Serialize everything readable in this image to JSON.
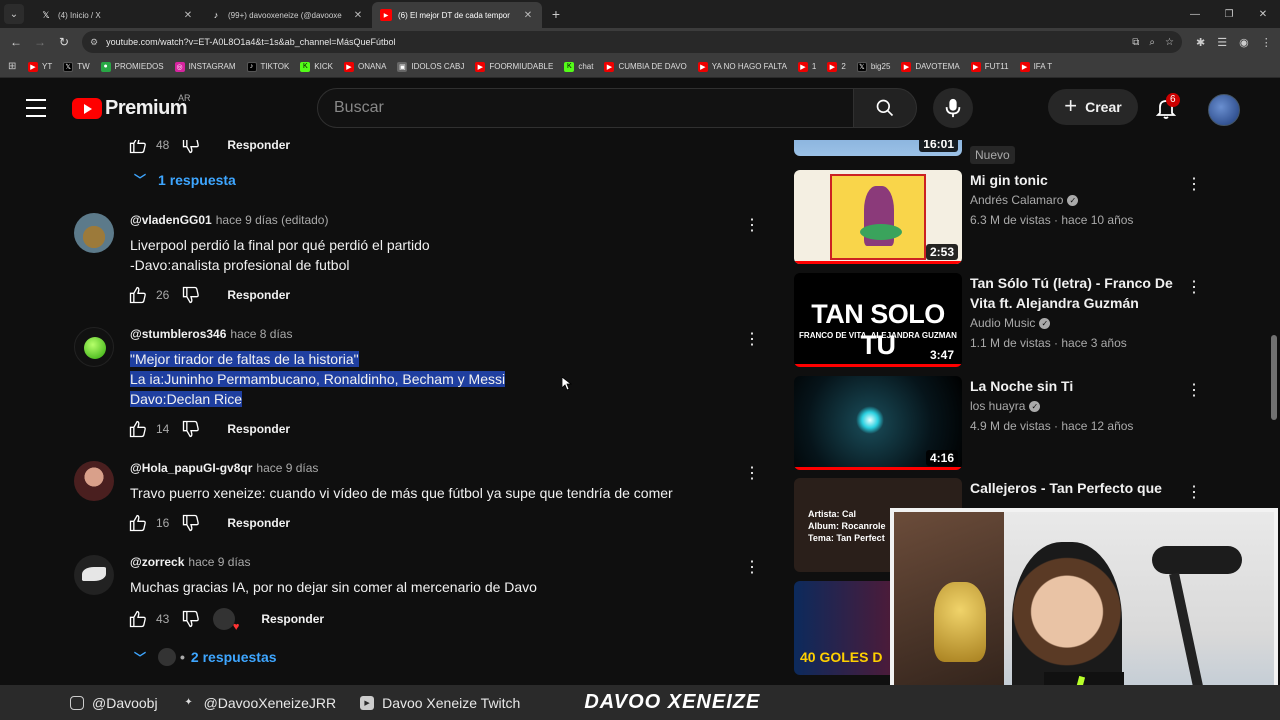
{
  "browser": {
    "tabs": [
      {
        "title": "(4) Inicio / X",
        "icon": "x-icon",
        "active": false
      },
      {
        "title": "(99+) davooxeneize (@davooxe",
        "icon": "tiktok-icon",
        "active": false
      },
      {
        "title": "(6) El mejor DT de cada tempor",
        "icon": "youtube-icon",
        "active": true
      }
    ],
    "new_tab": "+",
    "url": "youtube.com/watch?v=ET-A0L8O1a4&t=1s&ab_channel=MásQueFútbol",
    "bookmarks": [
      {
        "label": "YT",
        "icon": "yt"
      },
      {
        "label": "TW",
        "icon": "x"
      },
      {
        "label": "PROMIEDOS",
        "icon": "green"
      },
      {
        "label": "INSTAGRAM",
        "icon": "insta"
      },
      {
        "label": "TIKTOK",
        "icon": "tiktok"
      },
      {
        "label": "KICK",
        "icon": "kick"
      },
      {
        "label": "ONANA",
        "icon": "yt"
      },
      {
        "label": "IDOLOS CABJ",
        "icon": "gray"
      },
      {
        "label": "FOORMIUDABLE",
        "icon": "yt"
      },
      {
        "label": "chat",
        "icon": "kick"
      },
      {
        "label": "CUMBIA DE DAVO",
        "icon": "yt"
      },
      {
        "label": "YA NO HAGO FALTA",
        "icon": "yt"
      },
      {
        "label": "1",
        "icon": "yt"
      },
      {
        "label": "2",
        "icon": "yt"
      },
      {
        "label": "big25",
        "icon": "x"
      },
      {
        "label": "DAVOTEMA",
        "icon": "yt"
      },
      {
        "label": "FUT11",
        "icon": "yt"
      },
      {
        "label": "IFA T",
        "icon": "yt"
      }
    ]
  },
  "header": {
    "logo_text": "Premium",
    "country": "AR",
    "search_placeholder": "Buscar",
    "create_label": "Crear",
    "notifications_count": "6"
  },
  "comments": {
    "top_actions": {
      "likes": "48",
      "reply_label": "Responder"
    },
    "top_replies": "1 respuesta",
    "items": [
      {
        "user": "@vladenGG01",
        "time": "hace 9 días (editado)",
        "lines": [
          "Liverpool perdió la final por qué perdió el partido",
          "-Davo:analista profesional de futbol"
        ],
        "likes": "26",
        "reply_label": "Responder"
      },
      {
        "user": "@stumbleros346",
        "time": "hace 8 días",
        "lines": [
          "\"Mejor tirador de faltas de la historia\"",
          "La ia:Juninho Permambucano, Ronaldinho, Becham y Messi",
          "Davo:Declan Rice"
        ],
        "likes": "14",
        "reply_label": "Responder"
      },
      {
        "user": "@Hola_papuGI-gv8qr",
        "time": "hace 9 días",
        "lines": [
          "Travo puerro xeneize: cuando vi vídeo de más que fútbol ya supe que tendría de comer"
        ],
        "likes": "16",
        "reply_label": "Responder"
      },
      {
        "user": "@zorreck",
        "time": "hace 9 días",
        "lines": [
          "Muchas gracias IA, por no dejar sin comer al mercenario de Davo"
        ],
        "likes": "43",
        "reply_label": "Responder",
        "replies": "2 respuestas"
      }
    ]
  },
  "sidebar": {
    "top_partial": {
      "duration": "16:01",
      "badge": "Nuevo"
    },
    "videos": [
      {
        "title": "Mi gin tonic",
        "channel": "Andrés Calamaro",
        "verified": true,
        "meta": "6.3 M de vistas · hace 10 años",
        "duration": "2:53"
      },
      {
        "title": "Tan Sólo Tú (letra) - Franco De Vita  ft. Alejandra Guzmán",
        "channel": "Audio Music",
        "verified": true,
        "meta": "1.1 M de vistas · hace 3 años",
        "duration": "3:47",
        "thumb_text": "TAN SOLO TU",
        "thumb_sub": "FRANCO DE VITA, ALEJANDRA GUZMAN"
      },
      {
        "title": "La Noche sin Ti",
        "channel": "los huayra",
        "verified": true,
        "meta": "4.9 M de vistas · hace 12 años",
        "duration": "4:16"
      },
      {
        "title": "Callejeros - Tan Perfecto que",
        "thumb_lines": [
          "Artista: Cal",
          "Album: Rocanrole",
          "Tema: Tan Perfect"
        ]
      },
      {
        "thumb_text": "40 GOLES D"
      }
    ]
  },
  "stream": {
    "items": [
      "@Davoobj",
      "@DavooXeneizeJRR",
      "Davoo Xeneize Twitch"
    ],
    "brand": "DAVOO XENEIZE"
  }
}
